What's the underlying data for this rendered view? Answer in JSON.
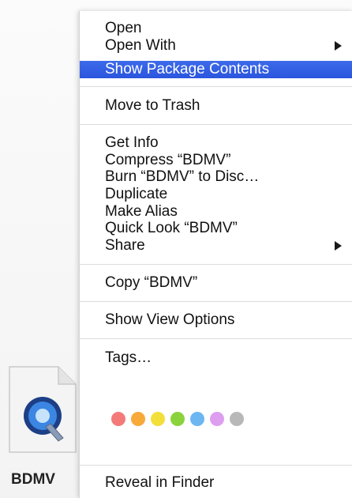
{
  "file": {
    "name": "BDMV",
    "icon": "quicktime-file-icon"
  },
  "menu": {
    "items": {
      "open": "Open",
      "open_with": "Open With",
      "show_package_contents": "Show Package Contents",
      "move_to_trash": "Move to Trash",
      "get_info": "Get Info",
      "compress": "Compress “BDMV”",
      "burn": "Burn “BDMV” to Disc…",
      "duplicate": "Duplicate",
      "make_alias": "Make Alias",
      "quick_look": "Quick Look “BDMV”",
      "share": "Share",
      "copy": "Copy “BDMV”",
      "show_view_options": "Show View Options",
      "tags": "Tags…",
      "reveal_in_finder": "Reveal in Finder"
    },
    "submenu_icon": "chevron-right-icon",
    "highlight_color": "#2f5ce6"
  },
  "tags": [
    {
      "name": "red",
      "color": "#f47a7a"
    },
    {
      "name": "orange",
      "color": "#f7a93a"
    },
    {
      "name": "yellow",
      "color": "#f2df3a"
    },
    {
      "name": "green",
      "color": "#8bd33c"
    },
    {
      "name": "blue",
      "color": "#6cb6f2"
    },
    {
      "name": "purple",
      "color": "#dd9ef0"
    },
    {
      "name": "gray",
      "color": "#b8b8b8"
    }
  ]
}
